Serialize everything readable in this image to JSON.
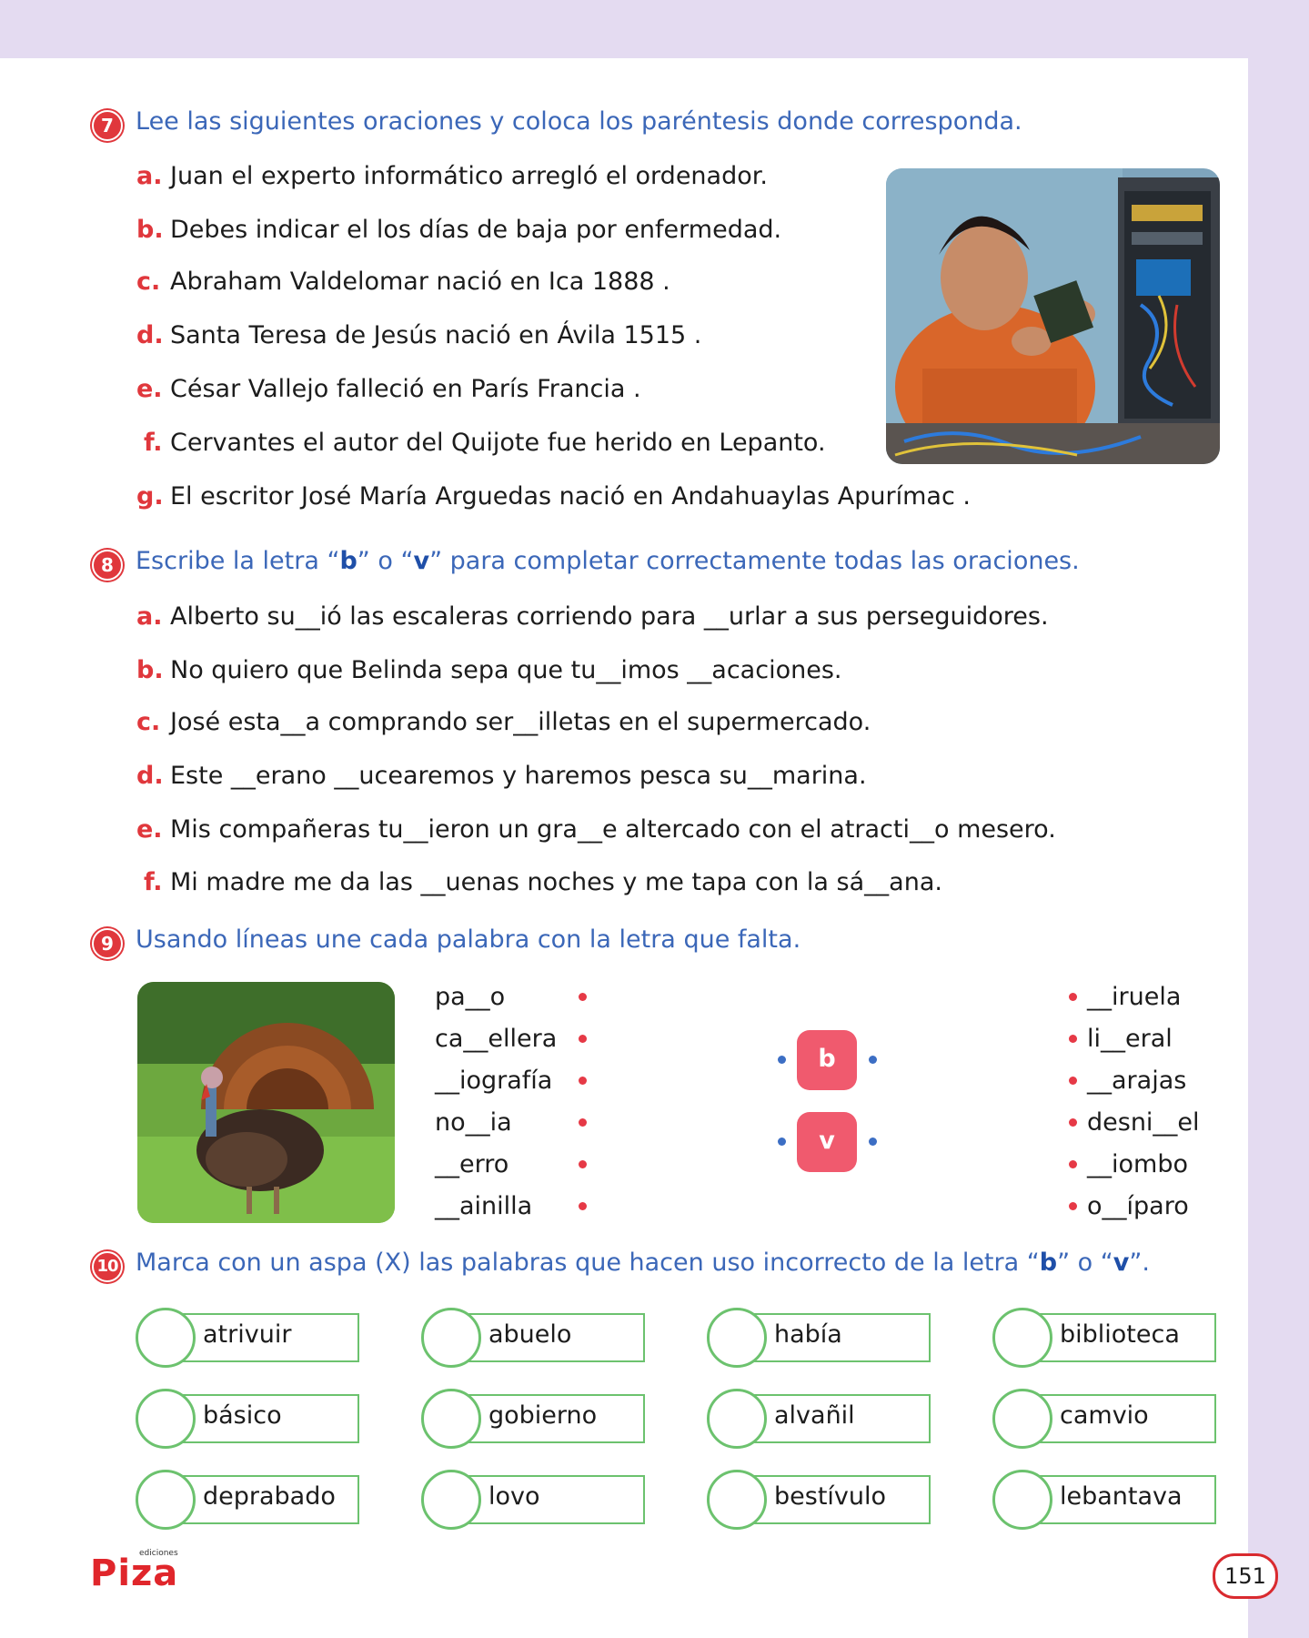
{
  "ex7": {
    "number": "7",
    "instruction": "Lee las siguientes oraciones y coloca los paréntesis donde corresponda.",
    "items": [
      {
        "letter": "a.",
        "text": "Juan  el experto informático  arregló el ordenador."
      },
      {
        "letter": "b.",
        "text": "Debes indicar el  los  días de baja por enfermedad."
      },
      {
        "letter": "c.",
        "text": "Abraham Valdelomar nació en Ica  1888 ."
      },
      {
        "letter": "d.",
        "text": "Santa Teresa de Jesús nació en Ávila  1515 ."
      },
      {
        "letter": "e.",
        "text": "César Vallejo falleció en París  Francia ."
      },
      {
        "letter": "f.",
        "text": "Cervantes  el autor del Quijote  fue herido en Lepanto."
      },
      {
        "letter": "g.",
        "text": "El escritor José María Arguedas nació en Andahuaylas  Apurímac ."
      }
    ]
  },
  "ex8": {
    "number": "8",
    "instruction_pre": "Escribe la letra “",
    "b": "b",
    "instruction_mid": "” o “",
    "v": "v",
    "instruction_post": "” para completar correctamente todas las oraciones.",
    "items": [
      {
        "letter": "a.",
        "text": "Alberto su__ió las escaleras corriendo para  __urlar a sus perseguidores."
      },
      {
        "letter": "b.",
        "text": "No quiero que Belinda sepa que tu__imos  __acaciones."
      },
      {
        "letter": "c.",
        "text": "José esta__a comprando ser__illetas en el supermercado."
      },
      {
        "letter": "d.",
        "text": "Este  __erano  __ucearemos y haremos pesca su__marina."
      },
      {
        "letter": "e.",
        "text": "Mis compañeras tu__ieron un gra__e altercado con el atracti__o mesero."
      },
      {
        "letter": "f.",
        "text": "Mi madre me da las  __uenas noches y me tapa con la sá__ana."
      }
    ]
  },
  "ex9": {
    "number": "9",
    "instruction": "Usando líneas une cada palabra con la letra que falta.",
    "left_words": [
      "pa__o",
      "ca__ellera",
      "__iografía",
      "no__ia",
      "__erro",
      "__ainilla"
    ],
    "right_words": [
      "__iruela",
      "li__eral",
      "__arajas",
      "desni__el",
      "__iombo",
      "o__íparo"
    ],
    "letters": [
      "b",
      "v"
    ]
  },
  "ex10": {
    "number": "10",
    "instruction_pre": "Marca con un aspa (X) las palabras que hacen uso incorrecto de la letra “",
    "b": "b",
    "instruction_mid": "” o “",
    "v": "v",
    "instruction_post": "”.",
    "rows": [
      [
        "atrivuir",
        "abuelo",
        "había",
        "biblioteca"
      ],
      [
        "básico",
        "gobierno",
        "alvañil",
        "camvio"
      ],
      [
        "deprabado",
        "lovo",
        "bestívulo",
        "lebantava"
      ]
    ]
  },
  "footer": {
    "logo_small": "ediciones",
    "logo": "Piza",
    "page_number": "151"
  },
  "colors": {
    "accent_red": "#e0373c",
    "instruction_blue": "#3b67b8",
    "box_green": "#6cc26e",
    "letter_box_pink": "#f05a6e",
    "background_lavender": "#e4dbf1"
  }
}
